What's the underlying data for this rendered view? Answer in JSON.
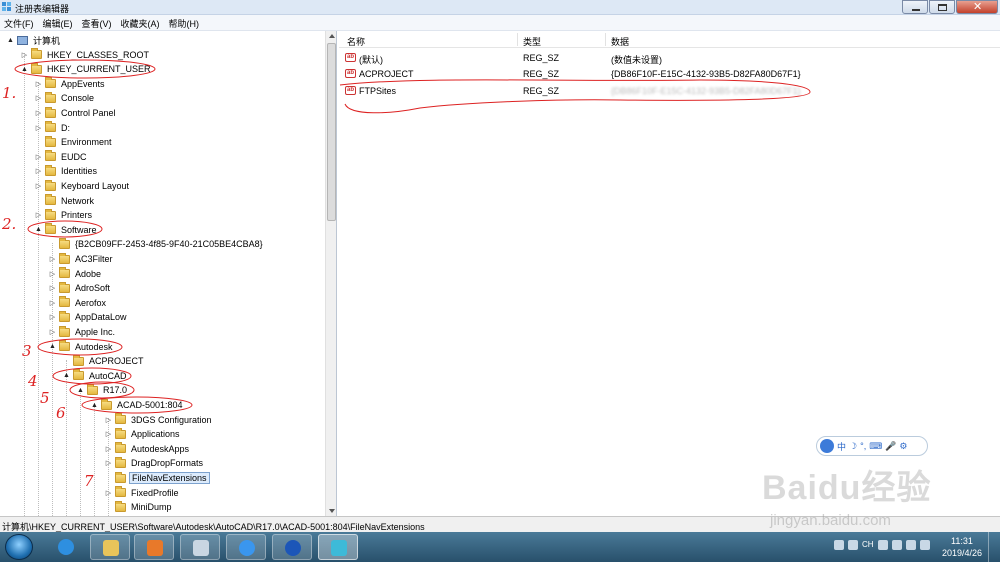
{
  "window": {
    "title": "注册表编辑器",
    "buttons": {
      "minimize": "minimize",
      "maximize": "maximize",
      "close": "close"
    }
  },
  "menu": [
    "文件(F)",
    "编辑(E)",
    "查看(V)",
    "收藏夹(A)",
    "帮助(H)"
  ],
  "tree": [
    {
      "label": "计算机",
      "icon": "computer-icon",
      "expander": "▲",
      "selected": false
    },
    {
      "label": "HKEY_CLASSES_ROOT",
      "icon": "folder-icon",
      "expander": "▷",
      "selected": false
    },
    {
      "label": "HKEY_CURRENT_USER",
      "icon": "folder-icon",
      "expander": "▲",
      "selected": false
    },
    {
      "label": "AppEvents",
      "icon": "folder-icon",
      "expander": "▷",
      "selected": false
    },
    {
      "label": "Console",
      "icon": "folder-icon",
      "expander": "▷",
      "selected": false
    },
    {
      "label": "Control Panel",
      "icon": "folder-icon",
      "expander": "▷",
      "selected": false
    },
    {
      "label": "D:",
      "icon": "folder-icon",
      "expander": "▷",
      "selected": false
    },
    {
      "label": "Environment",
      "icon": "folder-icon",
      "expander": "",
      "selected": false
    },
    {
      "label": "EUDC",
      "icon": "folder-icon",
      "expander": "▷",
      "selected": false
    },
    {
      "label": "Identities",
      "icon": "folder-icon",
      "expander": "▷",
      "selected": false
    },
    {
      "label": "Keyboard Layout",
      "icon": "folder-icon",
      "expander": "▷",
      "selected": false
    },
    {
      "label": "Network",
      "icon": "folder-icon",
      "expander": "",
      "selected": false
    },
    {
      "label": "Printers",
      "icon": "folder-icon",
      "expander": "▷",
      "selected": false
    },
    {
      "label": "Software",
      "icon": "folder-icon",
      "expander": "▲",
      "selected": false
    },
    {
      "label": "{B2CB09FF-2453-4f85-9F40-21C05BE4CBA8}",
      "icon": "folder-icon",
      "expander": "",
      "selected": false
    },
    {
      "label": "AC3Filter",
      "icon": "folder-icon",
      "expander": "▷",
      "selected": false
    },
    {
      "label": "Adobe",
      "icon": "folder-icon",
      "expander": "▷",
      "selected": false
    },
    {
      "label": "AdroSoft",
      "icon": "folder-icon",
      "expander": "▷",
      "selected": false
    },
    {
      "label": "Aerofox",
      "icon": "folder-icon",
      "expander": "▷",
      "selected": false
    },
    {
      "label": "AppDataLow",
      "icon": "folder-icon",
      "expander": "▷",
      "selected": false
    },
    {
      "label": "Apple Inc.",
      "icon": "folder-icon",
      "expander": "▷",
      "selected": false
    },
    {
      "label": "Autodesk",
      "icon": "folder-icon",
      "expander": "▲",
      "selected": false
    },
    {
      "label": "ACPROJECT",
      "icon": "folder-icon",
      "expander": "",
      "selected": false
    },
    {
      "label": "AutoCAD",
      "icon": "folder-icon",
      "expander": "▲",
      "selected": false
    },
    {
      "label": "R17.0",
      "icon": "folder-icon",
      "expander": "▲",
      "selected": false
    },
    {
      "label": "ACAD-5001:804",
      "icon": "folder-icon",
      "expander": "▲",
      "selected": false
    },
    {
      "label": "3DGS Configuration",
      "icon": "folder-icon",
      "expander": "▷",
      "selected": false
    },
    {
      "label": "Applications",
      "icon": "folder-icon",
      "expander": "▷",
      "selected": false
    },
    {
      "label": "AutodeskApps",
      "icon": "folder-icon",
      "expander": "▷",
      "selected": false
    },
    {
      "label": "DragDropFormats",
      "icon": "folder-icon",
      "expander": "▷",
      "selected": false
    },
    {
      "label": "FileNavExtensions",
      "icon": "folder-icon",
      "expander": "",
      "selected": true
    },
    {
      "label": "FixedProfile",
      "icon": "folder-icon",
      "expander": "▷",
      "selected": false
    },
    {
      "label": "MiniDump",
      "icon": "folder-icon",
      "expander": "",
      "selected": false
    }
  ],
  "list": {
    "columns": {
      "name": "名称",
      "type": "类型",
      "data": "数据"
    },
    "rows": [
      {
        "name": "(默认)",
        "type": "REG_SZ",
        "data": "(数值未设置)",
        "blurred": false
      },
      {
        "name": "ACPROJECT",
        "type": "REG_SZ",
        "data": "{DB86F10F-E15C-4132-93B5-D82FA80D67F1}",
        "blurred": false
      },
      {
        "name": "FTPSites",
        "type": "REG_SZ",
        "data": "{DB86F10F-E15C-4132-93B5-D82FA80D67F1}",
        "blurred": true
      }
    ]
  },
  "status": {
    "path": "计算机\\HKEY_CURRENT_USER\\Software\\Autodesk\\AutoCAD\\R17.0\\ACAD-5001:804\\FileNavExtensions"
  },
  "annotations": [
    "1.",
    "2.",
    "3",
    "4",
    "5",
    "6",
    "7"
  ],
  "ime": {
    "glyphs": [
      "中",
      "☽",
      "°,",
      "⌨",
      "🎤",
      "⚙"
    ]
  },
  "watermark": {
    "logo": "Baidu经验",
    "url": "jingyan.baidu.com"
  },
  "taskbar": {
    "apps": [
      "ie-icon",
      "explorer-icon",
      "media-player-icon",
      "calculator-icon",
      "baidu-netdisk-icon",
      "player-icon",
      "registry-editor-icon"
    ],
    "tray_lang": "CH",
    "clock_time": "11:31",
    "clock_date": "2019/4/26"
  },
  "colors": {
    "annotation": "#dd2222",
    "selection": "#dcebfc",
    "taskbar": "#3a6785"
  }
}
